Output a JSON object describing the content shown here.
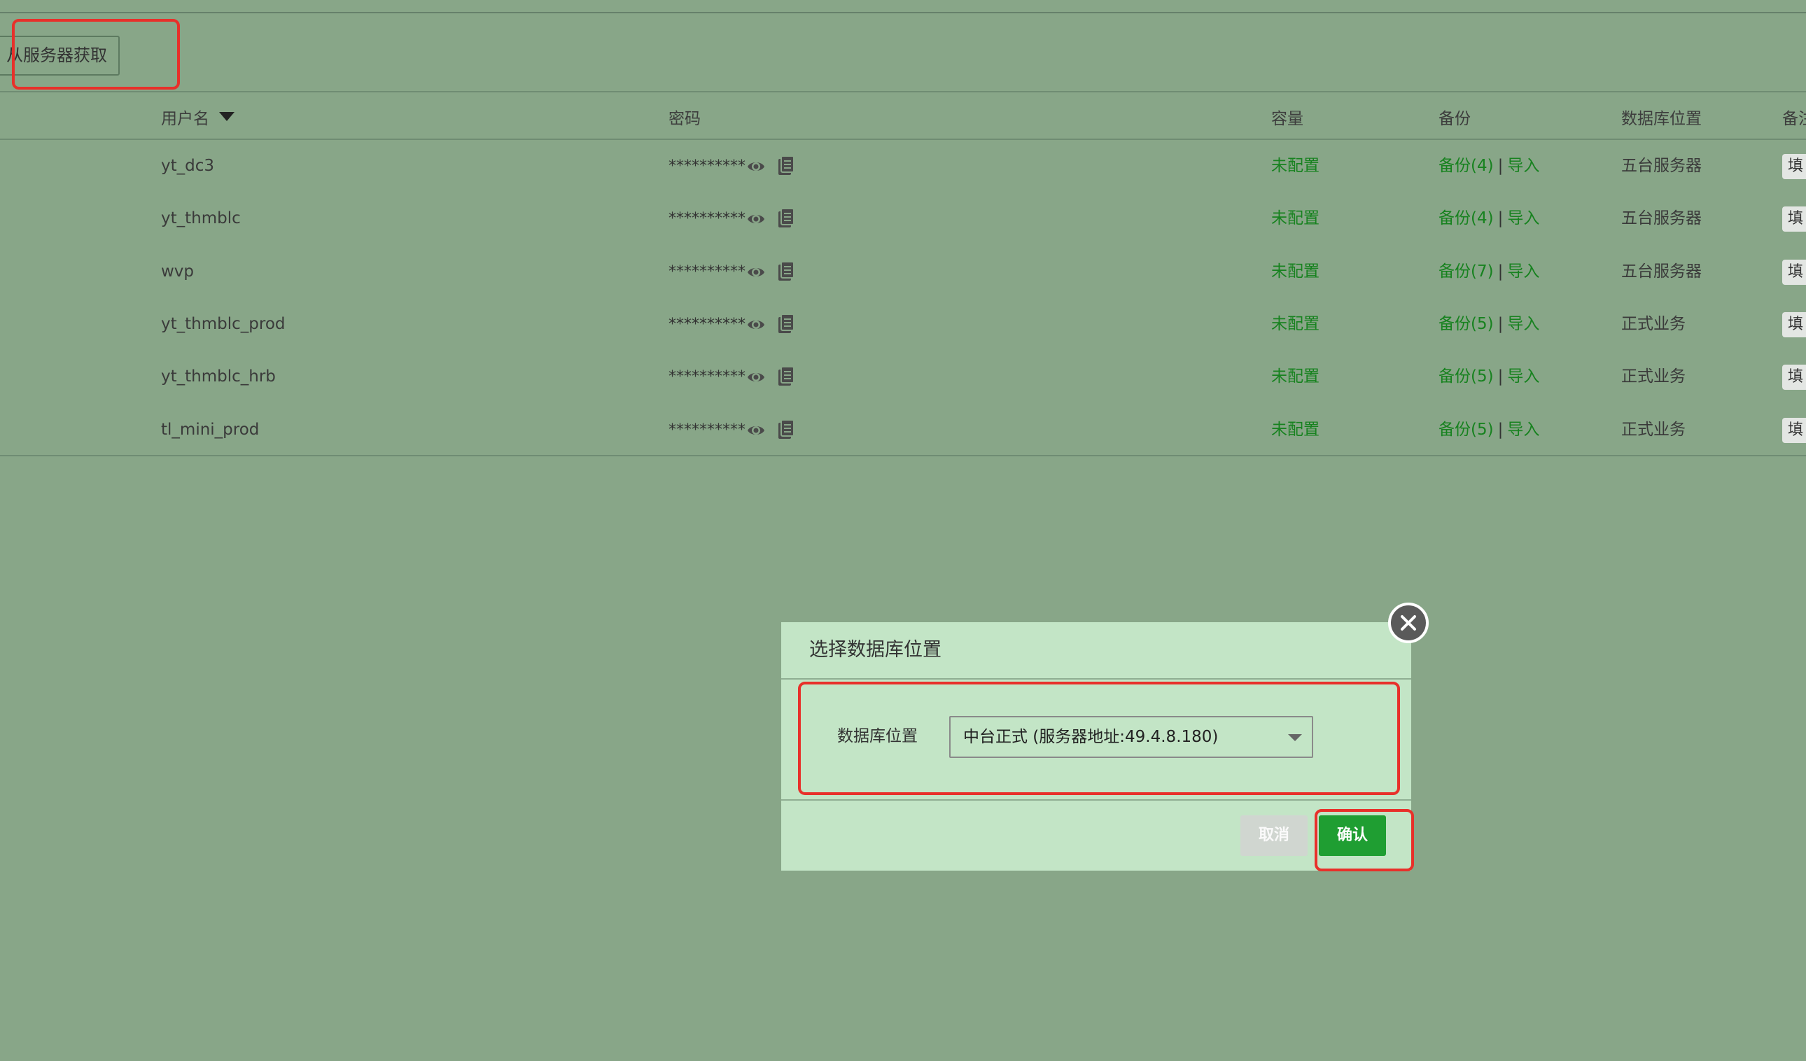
{
  "toolbar": {
    "fetch_from_server_label": "从服务器获取"
  },
  "table": {
    "headers": {
      "username": "用户名",
      "password": "密码",
      "capacity": "容量",
      "backup": "备份",
      "db_location": "数据库位置",
      "note": "备注"
    },
    "sort_column": "username",
    "rows": [
      {
        "username": "yt_dc3",
        "password": "**********",
        "capacity": "未配置",
        "backup": "备份(4)",
        "import": "导入",
        "location": "五台服务器",
        "note": "填"
      },
      {
        "username": "yt_thmblc",
        "password": "**********",
        "capacity": "未配置",
        "backup": "备份(4)",
        "import": "导入",
        "location": "五台服务器",
        "note": "填"
      },
      {
        "username": "wvp",
        "password": "**********",
        "capacity": "未配置",
        "backup": "备份(7)",
        "import": "导入",
        "location": "五台服务器",
        "note": "填"
      },
      {
        "username": "yt_thmblc_prod",
        "password": "**********",
        "capacity": "未配置",
        "backup": "备份(5)",
        "import": "导入",
        "location": "正式业务",
        "note": "填"
      },
      {
        "username": "yt_thmblc_hrb",
        "password": "**********",
        "capacity": "未配置",
        "backup": "备份(5)",
        "import": "导入",
        "location": "正式业务",
        "note": "填"
      },
      {
        "username": "tl_mini_prod",
        "password": "**********",
        "capacity": "未配置",
        "backup": "备份(5)",
        "import": "导入",
        "location": "正式业务",
        "note": "填"
      }
    ]
  },
  "modal": {
    "title": "选择数据库位置",
    "field_label": "数据库位置",
    "selected_value": "中台正式 (服务器地址:49.4.8.180)",
    "cancel_label": "取消",
    "confirm_label": "确认"
  },
  "colors": {
    "background": "#88a688",
    "modal_background": "#c3e5c6",
    "link_green": "#17821f",
    "confirm_green": "#1f9e32",
    "highlight_red": "#e8302a"
  },
  "icons": {
    "reveal": "eye-icon",
    "copy": "copy-icon",
    "close": "close-icon",
    "sort": "sort-caret-icon",
    "dropdown": "chevron-down-icon"
  }
}
